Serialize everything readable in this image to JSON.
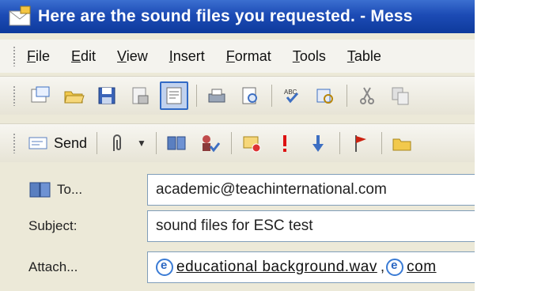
{
  "window": {
    "title": "Here are the sound files you requested. - Mess"
  },
  "menu": {
    "items": [
      "File",
      "Edit",
      "View",
      "Insert",
      "Format",
      "Tools",
      "Table"
    ]
  },
  "toolbar2": {
    "send_label": "Send"
  },
  "fields": {
    "to_label": "To...",
    "to_value": "academic@teachinternational.com",
    "subject_label": "Subject:",
    "subject_value": "sound files for ESC test",
    "attach_label": "Attach...",
    "attachments": [
      "educational background.wav",
      "com"
    ]
  },
  "icons": {
    "toolbar1": [
      "new-icon",
      "open-icon",
      "save-icon",
      "permission-icon",
      "print-preview-icon",
      "print-icon",
      "search-icon",
      "spellcheck-icon",
      "research-icon",
      "cut-icon",
      "copy-icon"
    ],
    "toolbar2": [
      "send-icon",
      "attach-icon",
      "address-book-icon",
      "check-names-icon",
      "options-icon",
      "importance-high-icon",
      "importance-low-icon",
      "flag-icon",
      "folder-icon"
    ]
  },
  "colors": {
    "titlebar": "#1c4bb5",
    "accent": "#316ac5"
  }
}
